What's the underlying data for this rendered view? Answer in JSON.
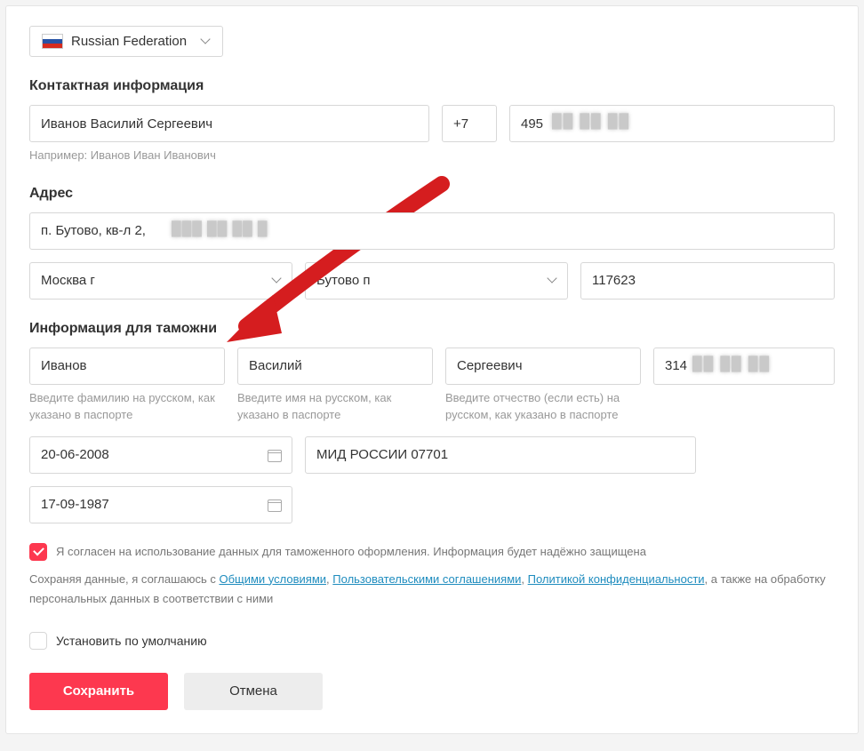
{
  "country": {
    "label": "Russian Federation"
  },
  "sections": {
    "contact": "Контактная информация",
    "address": "Адрес",
    "customs": "Информация для таможни"
  },
  "contact": {
    "fullname": "Иванов Василий Сергеевич",
    "hint": "Например: Иванов Иван Иванович",
    "prefix": "+7",
    "phone": "495"
  },
  "address": {
    "street": "п. Бутово, кв-л 2,",
    "city": "Москва г",
    "district": "Бутово п",
    "zip": "117623"
  },
  "customs": {
    "last": "Иванов",
    "first": "Василий",
    "middle": "Сергеевич",
    "id": "314",
    "last_hint": "Введите фамилию на русском, как указано в паспорте",
    "first_hint": "Введите имя на русском, как указано в паспорте",
    "middle_hint": "Введите отчество (если есть) на русском, как указано в паспорте",
    "issue_date": "20-06-2008",
    "issuer": "МИД РОССИИ 07701",
    "birth_date": "17-09-1987"
  },
  "consent": {
    "text": "Я согласен на использование данных для таможенного оформления. Информация будет надёжно защищена"
  },
  "legal": {
    "prefix": "Сохраняя данные, я соглашаюсь с ",
    "link1": "Общими условиями",
    "sep1": ", ",
    "link2": "Пользовательскими соглашениями",
    "sep2": ", ",
    "link3": "Политикой конфиденциальности",
    "suffix": ", а также на обработку персональных данных в соответствии с ними"
  },
  "default_label": "Установить по умолчанию",
  "buttons": {
    "save": "Сохранить",
    "cancel": "Отмена"
  }
}
